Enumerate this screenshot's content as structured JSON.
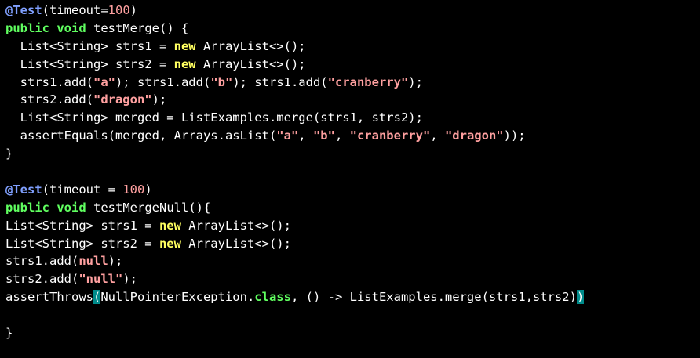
{
  "editor": {
    "lines": [
      [
        {
          "t": "@Test",
          "c": "ann"
        },
        {
          "t": "(timeout=",
          "c": "plain"
        },
        {
          "t": "100",
          "c": "num"
        },
        {
          "t": ")",
          "c": "plain"
        }
      ],
      [
        {
          "t": "public",
          "c": "kw"
        },
        {
          "t": " ",
          "c": "plain"
        },
        {
          "t": "void",
          "c": "kw"
        },
        {
          "t": " testMerge() {",
          "c": "plain"
        }
      ],
      [
        {
          "t": "  List<String> strs1 = ",
          "c": "plain"
        },
        {
          "t": "new",
          "c": "new"
        },
        {
          "t": " ArrayList<>();",
          "c": "plain"
        }
      ],
      [
        {
          "t": "  List<String> strs2 = ",
          "c": "plain"
        },
        {
          "t": "new",
          "c": "new"
        },
        {
          "t": " ArrayList<>();",
          "c": "plain"
        }
      ],
      [
        {
          "t": "  strs1.add(",
          "c": "plain"
        },
        {
          "t": "\"a\"",
          "c": "str"
        },
        {
          "t": "); strs1.add(",
          "c": "plain"
        },
        {
          "t": "\"b\"",
          "c": "str"
        },
        {
          "t": "); strs1.add(",
          "c": "plain"
        },
        {
          "t": "\"cranberry\"",
          "c": "str"
        },
        {
          "t": ");",
          "c": "plain"
        }
      ],
      [
        {
          "t": "  strs2.add(",
          "c": "plain"
        },
        {
          "t": "\"dragon\"",
          "c": "str"
        },
        {
          "t": ");",
          "c": "plain"
        }
      ],
      [
        {
          "t": "  List<String> merged = ListExamples.merge(strs1, strs2);",
          "c": "plain"
        }
      ],
      [
        {
          "t": "  assertEquals(merged, Arrays.asList(",
          "c": "plain"
        },
        {
          "t": "\"a\"",
          "c": "str"
        },
        {
          "t": ", ",
          "c": "plain"
        },
        {
          "t": "\"b\"",
          "c": "str"
        },
        {
          "t": ", ",
          "c": "plain"
        },
        {
          "t": "\"cranberry\"",
          "c": "str"
        },
        {
          "t": ", ",
          "c": "plain"
        },
        {
          "t": "\"dragon\"",
          "c": "str"
        },
        {
          "t": "));",
          "c": "plain"
        }
      ],
      [
        {
          "t": "}",
          "c": "plain"
        }
      ],
      [],
      [
        {
          "t": "@Test",
          "c": "ann"
        },
        {
          "t": "(timeout = ",
          "c": "plain"
        },
        {
          "t": "100",
          "c": "num"
        },
        {
          "t": ")",
          "c": "plain"
        }
      ],
      [
        {
          "t": "public",
          "c": "kw"
        },
        {
          "t": " ",
          "c": "plain"
        },
        {
          "t": "void",
          "c": "kw"
        },
        {
          "t": " testMergeNull(){",
          "c": "plain"
        }
      ],
      [
        {
          "t": "List<String> strs1 = ",
          "c": "plain"
        },
        {
          "t": "new",
          "c": "new"
        },
        {
          "t": " ArrayList<>();",
          "c": "plain"
        }
      ],
      [
        {
          "t": "List<String> strs2 = ",
          "c": "plain"
        },
        {
          "t": "new",
          "c": "new"
        },
        {
          "t": " ArrayList<>();",
          "c": "plain"
        }
      ],
      [
        {
          "t": "strs1.add(",
          "c": "plain"
        },
        {
          "t": "null",
          "c": "null"
        },
        {
          "t": ");",
          "c": "plain"
        }
      ],
      [
        {
          "t": "strs2.add(",
          "c": "plain"
        },
        {
          "t": "\"null\"",
          "c": "str"
        },
        {
          "t": ");",
          "c": "plain"
        }
      ],
      [
        {
          "t": "assertThrows",
          "c": "plain"
        },
        {
          "t": "(",
          "c": "match"
        },
        {
          "t": "NullPointerException.",
          "c": "plain"
        },
        {
          "t": "class",
          "c": "class"
        },
        {
          "t": ", () -> ListExamples.merge(strs1,strs2)",
          "c": "plain"
        },
        {
          "t": ")",
          "c": "match"
        }
      ],
      [],
      [
        {
          "t": "}",
          "c": "plain"
        }
      ]
    ]
  },
  "colors": {
    "background": "#000000",
    "annotation": "#80a0ff",
    "keyword": "#60ff60",
    "new_keyword": "#ffff60",
    "string_literal": "#ffa0a0",
    "plain_text": "#ffffff",
    "bracket_match_highlight": "#008b8b"
  }
}
